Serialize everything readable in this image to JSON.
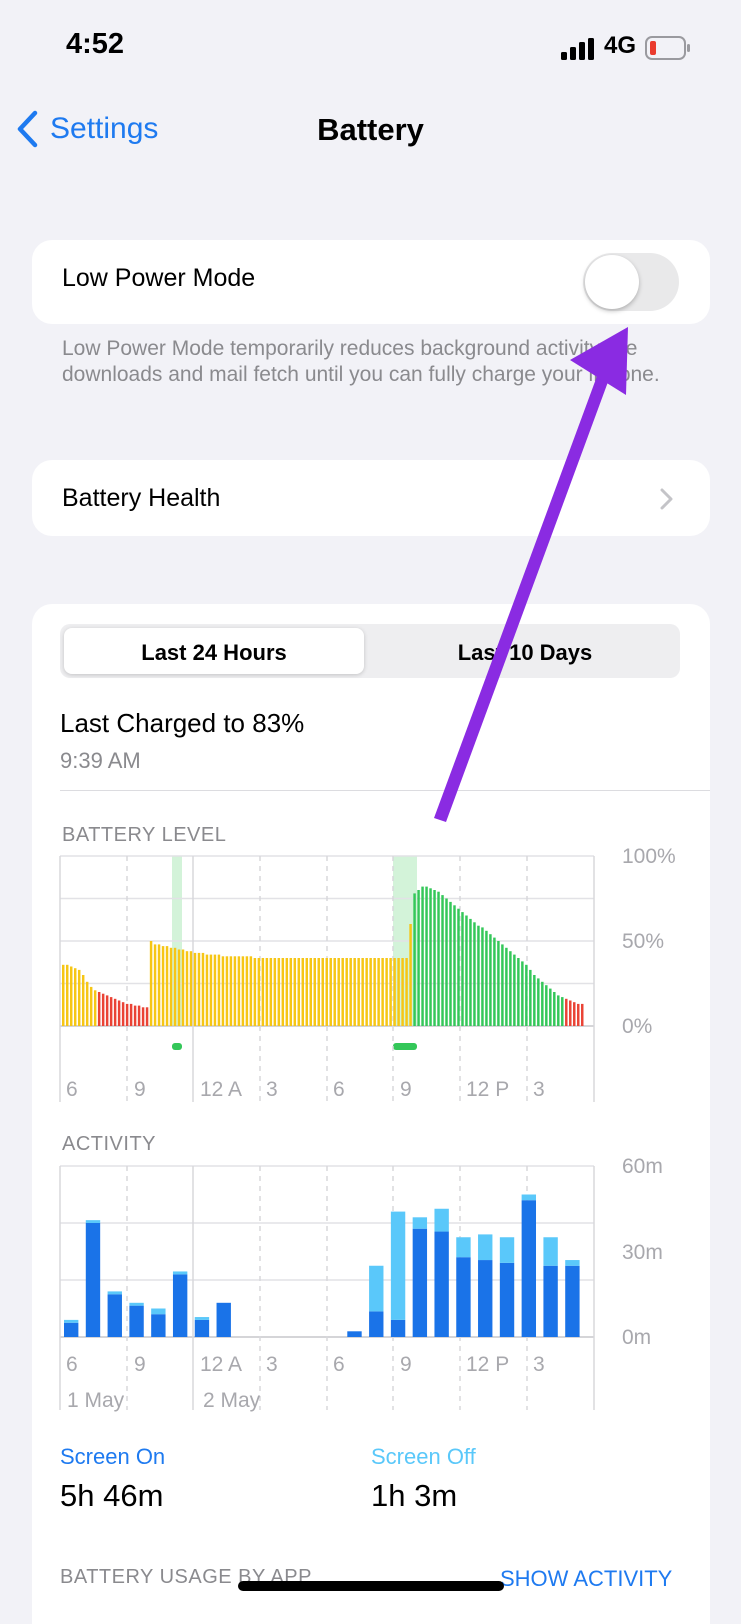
{
  "status": {
    "time": "4:52",
    "network": "4G"
  },
  "nav": {
    "back_label": "Settings",
    "title": "Battery"
  },
  "low_power": {
    "label": "Low Power Mode",
    "enabled": false,
    "description": "Low Power Mode temporarily reduces background activity like downloads and mail fetch until you can fully charge your iPhone."
  },
  "battery_health": {
    "label": "Battery Health"
  },
  "segments": {
    "active": "Last 24 Hours",
    "inactive": "Last 10 Days"
  },
  "last_charged": {
    "label": "Last Charged to 83%",
    "time": "9:39 AM"
  },
  "sections": {
    "level": "BATTERY LEVEL",
    "activity": "ACTIVITY",
    "usage": "BATTERY USAGE BY APP",
    "show_activity": "SHOW ACTIVITY"
  },
  "screen": {
    "on_label": "Screen On",
    "on_value": "5h 46m",
    "off_label": "Screen Off",
    "off_value": "1h 3m"
  },
  "colors": {
    "accent": "#1e7af0",
    "screen_off": "#5ac8fa",
    "level_yellow": "#f6c615",
    "level_red": "#ea4335",
    "level_green": "#34c759",
    "annotation_arrow": "#8a2be2"
  },
  "chart_data": [
    {
      "type": "bar",
      "title": "BATTERY LEVEL",
      "y_ticks": [
        "100%",
        "50%",
        "0%"
      ],
      "ylim": [
        0,
        100
      ],
      "x_ticks": [
        "6",
        "9",
        "12 A",
        "3",
        "6",
        "9",
        "12 P",
        "3"
      ],
      "charging_periods": [
        "~11 PM",
        "~8:30-9:30 AM"
      ],
      "values": [
        36,
        36,
        35,
        34,
        33,
        30,
        26,
        23,
        21,
        20,
        19,
        18,
        17,
        16,
        15,
        14,
        13,
        13,
        12,
        12,
        11,
        11,
        50,
        48,
        48,
        47,
        47,
        46,
        46,
        45,
        45,
        44,
        44,
        43,
        43,
        43,
        42,
        42,
        42,
        42,
        41,
        41,
        41,
        41,
        41,
        41,
        41,
        41,
        40,
        40,
        40,
        40,
        40,
        40,
        40,
        40,
        40,
        40,
        40,
        40,
        40,
        40,
        40,
        40,
        40,
        40,
        40,
        40,
        40,
        40,
        40,
        40,
        40,
        40,
        40,
        40,
        40,
        40,
        40,
        40,
        40,
        40,
        40,
        40,
        40,
        40,
        40,
        60,
        78,
        80,
        82,
        82,
        81,
        80,
        79,
        77,
        75,
        73,
        71,
        69,
        67,
        65,
        63,
        61,
        59,
        58,
        56,
        54,
        52,
        50,
        48,
        46,
        44,
        42,
        40,
        38,
        36,
        33,
        30,
        28,
        26,
        24,
        22,
        20,
        18,
        17,
        16,
        15,
        14,
        13,
        13
      ],
      "series_colors": "yellow above 20%, red at or below 20%, green after charge at 9 AM"
    },
    {
      "type": "bar",
      "title": "ACTIVITY",
      "y_ticks": [
        "60m",
        "30m",
        "0m"
      ],
      "ylim": [
        0,
        60
      ],
      "x_ticks": [
        "6",
        "9",
        "12 A",
        "3",
        "6",
        "9",
        "12 P",
        "3"
      ],
      "date_labels": [
        "1 May",
        "2 May"
      ],
      "series": [
        {
          "name": "Screen On",
          "values": [
            5,
            40,
            15,
            11,
            8,
            22,
            6,
            12,
            0,
            0,
            0,
            0,
            0,
            2,
            9,
            6,
            38,
            37,
            28,
            27,
            26,
            48,
            25,
            25
          ]
        },
        {
          "name": "Screen Off",
          "values": [
            1,
            1,
            1,
            1,
            2,
            1,
            1,
            0,
            0,
            0,
            0,
            0,
            0,
            0,
            16,
            38,
            4,
            8,
            7,
            9,
            9,
            2,
            10,
            2
          ]
        }
      ]
    }
  ]
}
